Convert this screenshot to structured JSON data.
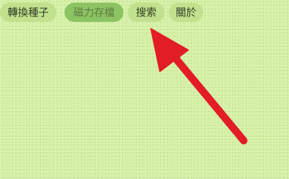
{
  "tabs": [
    {
      "label": "轉換種子",
      "active": false
    },
    {
      "label": "磁力存檔",
      "active": true
    },
    {
      "label": "搜索",
      "active": false
    },
    {
      "label": "關於",
      "active": false
    }
  ],
  "colors": {
    "background": "#d3f0a0",
    "tab_bg": "#c1e18e",
    "tab_active_bg": "#8cc463",
    "arrow": "#e21d26"
  },
  "annotation": {
    "icon": "red-arrow-annotation-icon",
    "points_to": "搜索"
  }
}
